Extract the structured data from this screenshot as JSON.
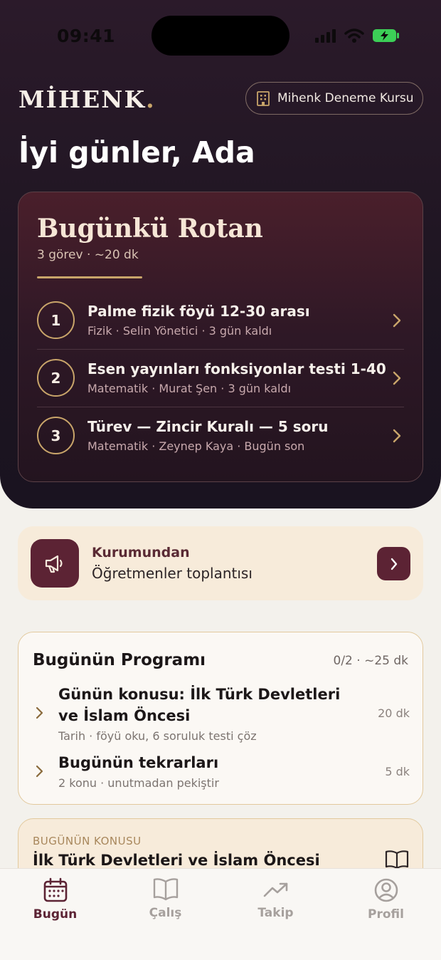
{
  "status_bar": {
    "time": "09:41"
  },
  "header": {
    "brand": "MİHENK",
    "brand_dot": ".",
    "institution": "Mihenk Deneme Kursu",
    "greeting": "İyi günler, Ada"
  },
  "route": {
    "title": "Bugünkü Rotan",
    "subtitle": "3 görev · ~20 dk",
    "tasks": [
      {
        "num": "1",
        "title": "Palme fizik föyü 12-30 arası",
        "meta": "Fizik · Selin Yönetici · 3 gün kaldı"
      },
      {
        "num": "2",
        "title": "Esen yayınları fonksiyonlar testi 1-40",
        "meta": "Matematik · Murat Şen · 3 gün kaldı"
      },
      {
        "num": "3",
        "title": "Türev — Zincir Kuralı — 5 soru",
        "meta": "Matematik · Zeynep Kaya · Bugün son"
      }
    ]
  },
  "notice": {
    "label": "Kurumundan",
    "text": "Öğretmenler toplantısı"
  },
  "program": {
    "title": "Bugünün Programı",
    "stats": "0/2 · ~25 dk",
    "items": [
      {
        "title": "Günün konusu: İlk Türk Devletleri ve İslam Öncesi",
        "meta": "Tarih · föyü oku, 6 soruluk testi çöz",
        "duration": "20 dk"
      },
      {
        "title": "Bugünün tekrarları",
        "meta": "2 konu · unutmadan pekiştir",
        "duration": "5 dk"
      }
    ]
  },
  "topic": {
    "label": "BUGÜNÜN KONUSU",
    "title": "İlk Türk Devletleri ve İslam Öncesi"
  },
  "tabs": [
    {
      "label": "Bugün",
      "icon": "calendar-icon",
      "active": true
    },
    {
      "label": "Çalış",
      "icon": "book-icon",
      "active": false
    },
    {
      "label": "Takip",
      "icon": "trend-icon",
      "active": false
    },
    {
      "label": "Profil",
      "icon": "profile-icon",
      "active": false
    }
  ],
  "colors": {
    "hero_bg": "#1d1521",
    "accent_gold": "#c9a56a",
    "brand_maroon": "#5c2334",
    "cream": "#f7ebda"
  }
}
